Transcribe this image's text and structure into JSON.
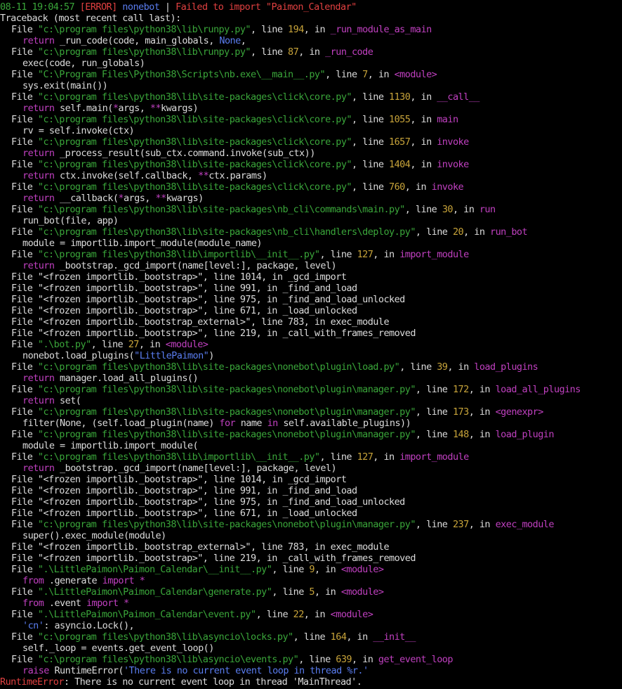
{
  "header": {
    "time": "08-11 19:04:57",
    "level": "[ERROR]",
    "logger": "nonebot",
    "sep": " | ",
    "message": "Failed to import \"Paimon_Calendar\""
  },
  "traceback_title": "Traceback (most recent call last):",
  "frames": [
    {
      "path": "\"c:\\program files\\python38\\lib\\runpy.py\"",
      "lineno": "194",
      "func": "_run_module_as_main",
      "code": [
        [
          "w",
          "return "
        ],
        [
          "w",
          "_run_code(code, main_globals, "
        ],
        [
          "b",
          "None"
        ],
        [
          "w",
          ",\n"
        ]
      ]
    },
    {
      "path": "\"c:\\program files\\python38\\lib\\runpy.py\"",
      "lineno": "87",
      "func": "_run_code",
      "code": [
        [
          "w",
          "exec(code, run_globals)"
        ]
      ]
    },
    {
      "path": "\"C:\\Program Files\\Python38\\Scripts\\nb.exe\\__main__.py\"",
      "lineno": "7",
      "func": "<module>",
      "code": [
        [
          "w",
          "sys.exit(main())"
        ]
      ]
    },
    {
      "path": "\"c:\\program files\\python38\\lib\\site-packages\\click\\core.py\"",
      "lineno": "1130",
      "func": "__call__",
      "code": [
        [
          "m",
          "return "
        ],
        [
          "w",
          "self.main("
        ],
        [
          "m",
          "*"
        ],
        [
          "w",
          "args, "
        ],
        [
          "m",
          "**"
        ],
        [
          "w",
          "kwargs)"
        ]
      ]
    },
    {
      "path": "\"c:\\program files\\python38\\lib\\site-packages\\click\\core.py\"",
      "lineno": "1055",
      "func": "main",
      "code": [
        [
          "w",
          "rv = self.invoke(ctx)"
        ]
      ]
    },
    {
      "path": "\"c:\\program files\\python38\\lib\\site-packages\\click\\core.py\"",
      "lineno": "1657",
      "func": "invoke",
      "code": [
        [
          "m",
          "return "
        ],
        [
          "w",
          "_process_result(sub_ctx.command.invoke(sub_ctx))"
        ]
      ]
    },
    {
      "path": "\"c:\\program files\\python38\\lib\\site-packages\\click\\core.py\"",
      "lineno": "1404",
      "func": "invoke",
      "code": [
        [
          "m",
          "return "
        ],
        [
          "w",
          "ctx.invoke(self.callback, "
        ],
        [
          "m",
          "**"
        ],
        [
          "w",
          "ctx.params)"
        ]
      ]
    },
    {
      "path": "\"c:\\program files\\python38\\lib\\site-packages\\click\\core.py\"",
      "lineno": "760",
      "func": "invoke",
      "code": [
        [
          "m",
          "return "
        ],
        [
          "w",
          "__callback("
        ],
        [
          "m",
          "*"
        ],
        [
          "w",
          "args, "
        ],
        [
          "m",
          "**"
        ],
        [
          "w",
          "kwargs)"
        ]
      ]
    },
    {
      "path": "\"c:\\program files\\python38\\lib\\site-packages\\nb_cli\\commands\\main.py\"",
      "lineno": "30",
      "func": "run",
      "code": [
        [
          "w",
          "run_bot(file, app)"
        ]
      ]
    },
    {
      "path": "\"c:\\program files\\python38\\lib\\site-packages\\nb_cli\\handlers\\deploy.py\"",
      "lineno": "20",
      "func": "run_bot",
      "code": [
        [
          "w",
          "module = importlib.import_module(module_name)"
        ]
      ]
    },
    {
      "path": "\"c:\\program files\\python38\\lib\\importlib\\__init__.py\"",
      "lineno": "127",
      "func": "import_module",
      "code": [
        [
          "m",
          "return "
        ],
        [
          "w",
          "_bootstrap._gcd_import(name[level:], package, level)"
        ]
      ]
    }
  ],
  "frozen_1": [
    "File \"<frozen importlib._bootstrap>\", line 1014, in _gcd_import",
    "File \"<frozen importlib._bootstrap>\", line 991, in _find_and_load",
    "File \"<frozen importlib._bootstrap>\", line 975, in _find_and_load_unlocked",
    "File \"<frozen importlib._bootstrap>\", line 671, in _load_unlocked",
    "File \"<frozen importlib._bootstrap_external>\", line 783, in exec_module",
    "File \"<frozen importlib._bootstrap>\", line 219, in _call_with_frames_removed"
  ],
  "frames2": [
    {
      "path": "\".\\bot.py\"",
      "lineno": "27",
      "func": "<module>",
      "code": [
        [
          "w",
          "nonebot.load_plugins("
        ],
        [
          "b",
          "\"LittlePaimon\""
        ],
        [
          "w",
          ")"
        ]
      ]
    },
    {
      "path": "\"c:\\program files\\python38\\lib\\site-packages\\nonebot\\plugin\\load.py\"",
      "lineno": "39",
      "func": "load_plugins",
      "code": [
        [
          "m",
          "return "
        ],
        [
          "w",
          "manager.load_all_plugins()"
        ]
      ]
    },
    {
      "path": "\"c:\\program files\\python38\\lib\\site-packages\\nonebot\\plugin\\manager.py\"",
      "lineno": "172",
      "func": "load_all_plugins",
      "code": [
        [
          "m",
          "return "
        ],
        [
          "w",
          "set("
        ]
      ]
    },
    {
      "path": "\"c:\\program files\\python38\\lib\\site-packages\\nonebot\\plugin\\manager.py\"",
      "lineno": "173",
      "func": "<genexpr>",
      "code": [
        [
          "w",
          "filter(None, (self.load_plugin(name) "
        ],
        [
          "m",
          "for "
        ],
        [
          "w",
          "name "
        ],
        [
          "m",
          "in "
        ],
        [
          "w",
          "self.available_plugins))"
        ]
      ]
    },
    {
      "path": "\"c:\\program files\\python38\\lib\\site-packages\\nonebot\\plugin\\manager.py\"",
      "lineno": "148",
      "func": "load_plugin",
      "marker": ">",
      "code": [
        [
          "w",
          "module = importlib.import_module("
        ]
      ]
    },
    {
      "path": "\"c:\\program files\\python38\\lib\\importlib\\__init__.py\"",
      "lineno": "127",
      "func": "import_module",
      "code": [
        [
          "m",
          "return "
        ],
        [
          "w",
          "_bootstrap._gcd_import(name[level:], package, level)"
        ]
      ]
    }
  ],
  "frozen_2": [
    "File \"<frozen importlib._bootstrap>\", line 1014, in _gcd_import",
    "File \"<frozen importlib._bootstrap>\", line 991, in _find_and_load",
    "File \"<frozen importlib._bootstrap>\", line 975, in _find_and_load_unlocked",
    "File \"<frozen importlib._bootstrap>\", line 671, in _load_unlocked"
  ],
  "frames3": [
    {
      "path": "\"c:\\program files\\python38\\lib\\site-packages\\nonebot\\plugin\\manager.py\"",
      "lineno": "237",
      "func": "exec_module",
      "code": [
        [
          "w",
          "super().exec_module(module)"
        ]
      ]
    }
  ],
  "frozen_3": [
    "File \"<frozen importlib._bootstrap_external>\", line 783, in exec_module",
    "File \"<frozen importlib._bootstrap>\", line 219, in _call_with_frames_removed"
  ],
  "frames4": [
    {
      "path": "\".\\LittlePaimon\\Paimon_Calendar\\__init__.py\"",
      "lineno": "9",
      "func": "<module>",
      "code": [
        [
          "m",
          "from "
        ],
        [
          "w",
          "."
        ],
        [
          "w",
          "generate "
        ],
        [
          "m",
          "import "
        ],
        [
          "m",
          "*"
        ]
      ]
    },
    {
      "path": "\".\\LittlePaimon\\Paimon_Calendar\\generate.py\"",
      "lineno": "5",
      "func": "<module>",
      "code": [
        [
          "m",
          "from "
        ],
        [
          "w",
          "."
        ],
        [
          "w",
          "event "
        ],
        [
          "m",
          "import "
        ],
        [
          "m",
          "*"
        ]
      ]
    },
    {
      "path": "\".\\LittlePaimon\\Paimon_Calendar\\event.py\"",
      "lineno": "22",
      "func": "<module>",
      "code": [
        [
          "b",
          "'cn'"
        ],
        [
          "w",
          ": asyncio.Lock(),"
        ]
      ]
    },
    {
      "path": "\"c:\\program files\\python38\\lib\\asyncio\\locks.py\"",
      "lineno": "164",
      "func": "__init__",
      "code": [
        [
          "w",
          "self._loop = events.get_event_loop()"
        ]
      ]
    },
    {
      "path": "\"c:\\program files\\python38\\lib\\asyncio\\events.py\"",
      "lineno": "639",
      "func": "get_event_loop",
      "code": [
        [
          "m",
          "raise "
        ],
        [
          "w",
          "RuntimeError("
        ],
        [
          "b",
          "'There is no current event loop in thread %r.'"
        ]
      ]
    }
  ],
  "final_error": {
    "type": "RuntimeError",
    "message": ": There is no current event loop in thread 'MainThread'."
  },
  "labels": {
    "file": "File ",
    "line": ", line ",
    "in": ", in "
  }
}
